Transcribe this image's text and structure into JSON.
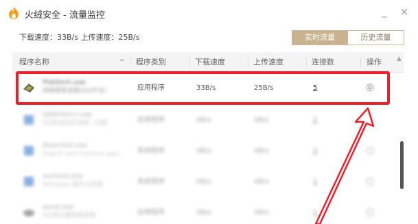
{
  "window": {
    "title": "火绒安全 - 流量监控",
    "minimize_icon": "minimize-icon",
    "close_icon": "close-icon"
  },
  "summary": {
    "text": "下载速度：33B/s 上传速度：25B/s"
  },
  "tabs": [
    {
      "label": "实时流量",
      "active": true
    },
    {
      "label": "历史流量",
      "active": false
    }
  ],
  "table": {
    "headers": [
      "程序名称",
      "程序类别",
      "下载速度",
      "上传速度",
      "连接数",
      "操作"
    ],
    "rows": [
      {
        "name": "Platform.exe",
        "desc": "网络更新进程(QQ平台)",
        "category": "应用程序",
        "down": "33B/s",
        "up": "25B/s",
        "conn": "5",
        "icon_color": "#6b6b3a"
      },
      {
        "name": "QQProtect.exe",
        "desc": "QQ安全防护进程（Q盾）",
        "category": "应用程序",
        "down": "0B/s",
        "up": "0B/s",
        "conn": "2",
        "icon_color": "#2a70c8"
      },
      {
        "name": "SearchUI.exe",
        "desc": "Search and Cortana appl...",
        "category": "系统程序",
        "down": "0B/s",
        "up": "0B/s",
        "conn": "2",
        "icon_color": "#2a70c8"
      },
      {
        "name": "svchost.exe",
        "desc": "Windows 服务主进程",
        "category": "系统程序",
        "down": "0B/s",
        "up": "0B/s",
        "conn": "1",
        "icon_color": "#2a70c8"
      },
      {
        "name": "qvod.exe",
        "desc": "QQ音乐播放器进程",
        "category": "应用程序",
        "down": "0B/s",
        "up": "0B/s",
        "conn": "1",
        "icon_color": "#555555"
      }
    ]
  },
  "colors": {
    "accent": "#c8b38e",
    "highlight": "#e8212a"
  }
}
